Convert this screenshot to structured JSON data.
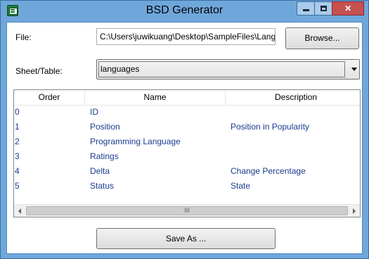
{
  "window": {
    "title": "BSD Generator",
    "controls": {
      "minimize": "",
      "maximize": "",
      "close": "✕"
    }
  },
  "form": {
    "file_label": "File:",
    "file_path": "C:\\Users\\juwikuang\\Desktop\\SampleFiles\\Lang",
    "browse_label": "Browse...",
    "sheet_label": "Sheet/Table:",
    "sheet_selected": "languages"
  },
  "table": {
    "columns": [
      "Order",
      "Name",
      "Description"
    ],
    "rows": [
      {
        "order": "0",
        "name": "ID",
        "description": ""
      },
      {
        "order": "1",
        "name": "Position",
        "description": "Position in Popularity"
      },
      {
        "order": "2",
        "name": "Programming Language",
        "description": ""
      },
      {
        "order": "3",
        "name": "Ratings",
        "description": ""
      },
      {
        "order": "4",
        "name": "Delta",
        "description": "Change Percentage"
      },
      {
        "order": "5",
        "name": "Status",
        "description": "State"
      }
    ],
    "scroll_thumb_glyph": "III"
  },
  "actions": {
    "save_as_label": "Save As ..."
  },
  "colors": {
    "frame": "#6fa7db",
    "close_button": "#c75050",
    "row_text": "#1a3b8f"
  },
  "icons": {
    "app": "excel-app-icon",
    "combo": "chevron-down-icon",
    "scroll_left": "arrow-left-icon",
    "scroll_right": "arrow-right-icon"
  }
}
